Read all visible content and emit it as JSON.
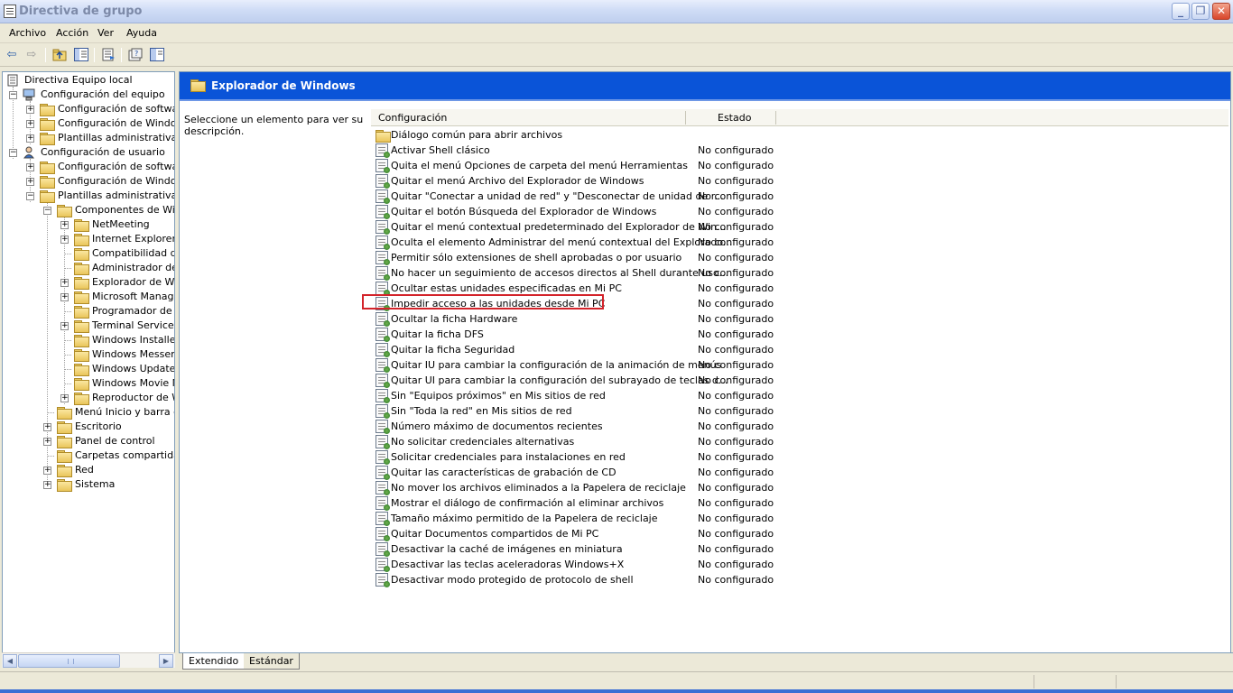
{
  "window": {
    "title": "Directiva de grupo"
  },
  "menu": [
    "Archivo",
    "Acción",
    "Ver",
    "Ayuda"
  ],
  "tree": [
    {
      "label": "Directiva Equipo local",
      "level": 0,
      "icon": "policy-doc-icon",
      "expander": ""
    },
    {
      "label": "Configuración del equipo",
      "level": 1,
      "icon": "computer-icon",
      "expander": "-"
    },
    {
      "label": "Configuración de software",
      "level": 2,
      "icon": "folder-icon",
      "expander": "+"
    },
    {
      "label": "Configuración de Windows",
      "level": 2,
      "icon": "folder-icon",
      "expander": "+"
    },
    {
      "label": "Plantillas administrativas",
      "level": 2,
      "icon": "folder-icon",
      "expander": "+"
    },
    {
      "label": "Configuración de usuario",
      "level": 1,
      "icon": "user-icon",
      "expander": "-"
    },
    {
      "label": "Configuración de software",
      "level": 2,
      "icon": "folder-icon",
      "expander": "+"
    },
    {
      "label": "Configuración de Windows",
      "level": 2,
      "icon": "folder-icon",
      "expander": "+"
    },
    {
      "label": "Plantillas administrativas",
      "level": 2,
      "icon": "folder-icon",
      "expander": "-"
    },
    {
      "label": "Componentes de Windo",
      "level": 3,
      "icon": "folder-icon",
      "expander": "-"
    },
    {
      "label": "NetMeeting",
      "level": 4,
      "icon": "folder-icon",
      "expander": "+"
    },
    {
      "label": "Internet Explorer",
      "level": 4,
      "icon": "folder-icon",
      "expander": "+"
    },
    {
      "label": "Compatibilidad de a",
      "level": 4,
      "icon": "folder-icon",
      "expander": ""
    },
    {
      "label": "Administrador de d",
      "level": 4,
      "icon": "folder-icon",
      "expander": ""
    },
    {
      "label": "Explorador de Wind",
      "level": 4,
      "icon": "open-folder-icon",
      "expander": "+"
    },
    {
      "label": "Microsoft Managem",
      "level": 4,
      "icon": "folder-icon",
      "expander": "+"
    },
    {
      "label": "Programador de ta",
      "level": 4,
      "icon": "folder-icon",
      "expander": ""
    },
    {
      "label": "Terminal Services",
      "level": 4,
      "icon": "folder-icon",
      "expander": "+"
    },
    {
      "label": "Windows Installer",
      "level": 4,
      "icon": "folder-icon",
      "expander": ""
    },
    {
      "label": "Windows Messenge",
      "level": 4,
      "icon": "folder-icon",
      "expander": ""
    },
    {
      "label": "Windows Update",
      "level": 4,
      "icon": "folder-icon",
      "expander": ""
    },
    {
      "label": "Windows Movie Ma",
      "level": 4,
      "icon": "folder-icon",
      "expander": ""
    },
    {
      "label": "Reproductor de Wi",
      "level": 4,
      "icon": "folder-icon",
      "expander": "+"
    },
    {
      "label": "Menú Inicio y barra de",
      "level": 3,
      "icon": "folder-icon",
      "expander": ""
    },
    {
      "label": "Escritorio",
      "level": 3,
      "icon": "folder-icon",
      "expander": "+"
    },
    {
      "label": "Panel de control",
      "level": 3,
      "icon": "folder-icon",
      "expander": "+"
    },
    {
      "label": "Carpetas compartidas",
      "level": 3,
      "icon": "folder-icon",
      "expander": ""
    },
    {
      "label": "Red",
      "level": 3,
      "icon": "folder-icon",
      "expander": "+"
    },
    {
      "label": "Sistema",
      "level": 3,
      "icon": "folder-icon",
      "expander": "+"
    }
  ],
  "main": {
    "header_title": "Explorador de Windows",
    "description": "Seleccione un elemento para ver su descripción.",
    "columns": [
      "Configuración",
      "Estado"
    ],
    "rows": [
      {
        "name": "Diálogo común para abrir archivos",
        "state": "",
        "icon": "folder-icon"
      },
      {
        "name": "Activar Shell clásico",
        "state": "No configurado",
        "icon": "policy-setting-icon"
      },
      {
        "name": "Quita el menú Opciones de carpeta del menú Herramientas",
        "state": "No configurado",
        "icon": "policy-setting-icon"
      },
      {
        "name": "Quitar el menú Archivo del Explorador de Windows",
        "state": "No configurado",
        "icon": "policy-setting-icon"
      },
      {
        "name": "Quitar \"Conectar a unidad de red\" y \"Desconectar de unidad de r...",
        "state": "No configurado",
        "icon": "policy-setting-icon"
      },
      {
        "name": "Quitar el botón Búsqueda del Explorador de Windows",
        "state": "No configurado",
        "icon": "policy-setting-icon"
      },
      {
        "name": "Quitar el menú contextual predeterminado del Explorador de Win...",
        "state": "No configurado",
        "icon": "policy-setting-icon"
      },
      {
        "name": "Oculta el elemento Administrar del menú contextual del Explorado...",
        "state": "No configurado",
        "icon": "policy-setting-icon"
      },
      {
        "name": "Permitir sólo extensiones de shell aprobadas o por usuario",
        "state": "No configurado",
        "icon": "policy-setting-icon"
      },
      {
        "name": "No hacer un seguimiento de accesos directos al Shell durante uso...",
        "state": "No configurado",
        "icon": "policy-setting-icon"
      },
      {
        "name": "Ocultar estas unidades especificadas en Mi PC",
        "state": "No configurado",
        "icon": "policy-setting-icon"
      },
      {
        "name": "Impedir acceso a las unidades desde Mi PC",
        "state": "No configurado",
        "icon": "policy-setting-icon"
      },
      {
        "name": "Ocultar la ficha Hardware",
        "state": "No configurado",
        "icon": "policy-setting-icon"
      },
      {
        "name": "Quitar la ficha DFS",
        "state": "No configurado",
        "icon": "policy-setting-icon"
      },
      {
        "name": "Quitar la ficha Seguridad",
        "state": "No configurado",
        "icon": "policy-setting-icon"
      },
      {
        "name": "Quitar IU para cambiar la configuración de la animación de menús",
        "state": "No configurado",
        "icon": "policy-setting-icon"
      },
      {
        "name": "Quitar UI para cambiar la configuración del subrayado de teclas d...",
        "state": "No configurado",
        "icon": "policy-setting-icon"
      },
      {
        "name": "Sin \"Equipos próximos\" en Mis sitios de red",
        "state": "No configurado",
        "icon": "policy-setting-icon"
      },
      {
        "name": "Sin \"Toda la red\" en Mis sitios de red",
        "state": "No configurado",
        "icon": "policy-setting-icon"
      },
      {
        "name": "Número máximo de documentos recientes",
        "state": "No configurado",
        "icon": "policy-setting-icon"
      },
      {
        "name": "No solicitar credenciales alternativas",
        "state": "No configurado",
        "icon": "policy-setting-icon"
      },
      {
        "name": "Solicitar credenciales para instalaciones en red",
        "state": "No configurado",
        "icon": "policy-setting-icon"
      },
      {
        "name": "Quitar las características de grabación de CD",
        "state": "No configurado",
        "icon": "policy-setting-icon"
      },
      {
        "name": "No mover los archivos eliminados a la Papelera de reciclaje",
        "state": "No configurado",
        "icon": "policy-setting-icon"
      },
      {
        "name": "Mostrar el diálogo de confirmación al eliminar archivos",
        "state": "No configurado",
        "icon": "policy-setting-icon"
      },
      {
        "name": "Tamaño máximo permitido de la Papelera de reciclaje",
        "state": "No configurado",
        "icon": "policy-setting-icon"
      },
      {
        "name": "Quitar Documentos compartidos de Mi PC",
        "state": "No configurado",
        "icon": "policy-setting-icon"
      },
      {
        "name": "Desactivar la caché de imágenes en miniatura",
        "state": "No configurado",
        "icon": "policy-setting-icon"
      },
      {
        "name": "Desactivar las teclas aceleradoras Windows+X",
        "state": "No configurado",
        "icon": "policy-setting-icon"
      },
      {
        "name": "Desactivar modo protegido de protocolo de shell",
        "state": "No configurado",
        "icon": "policy-setting-icon"
      }
    ]
  },
  "tabs": [
    "Extendido",
    "Estándar"
  ],
  "colors": {
    "header_band": "#0a54d8",
    "highlight": "#d3232a"
  }
}
